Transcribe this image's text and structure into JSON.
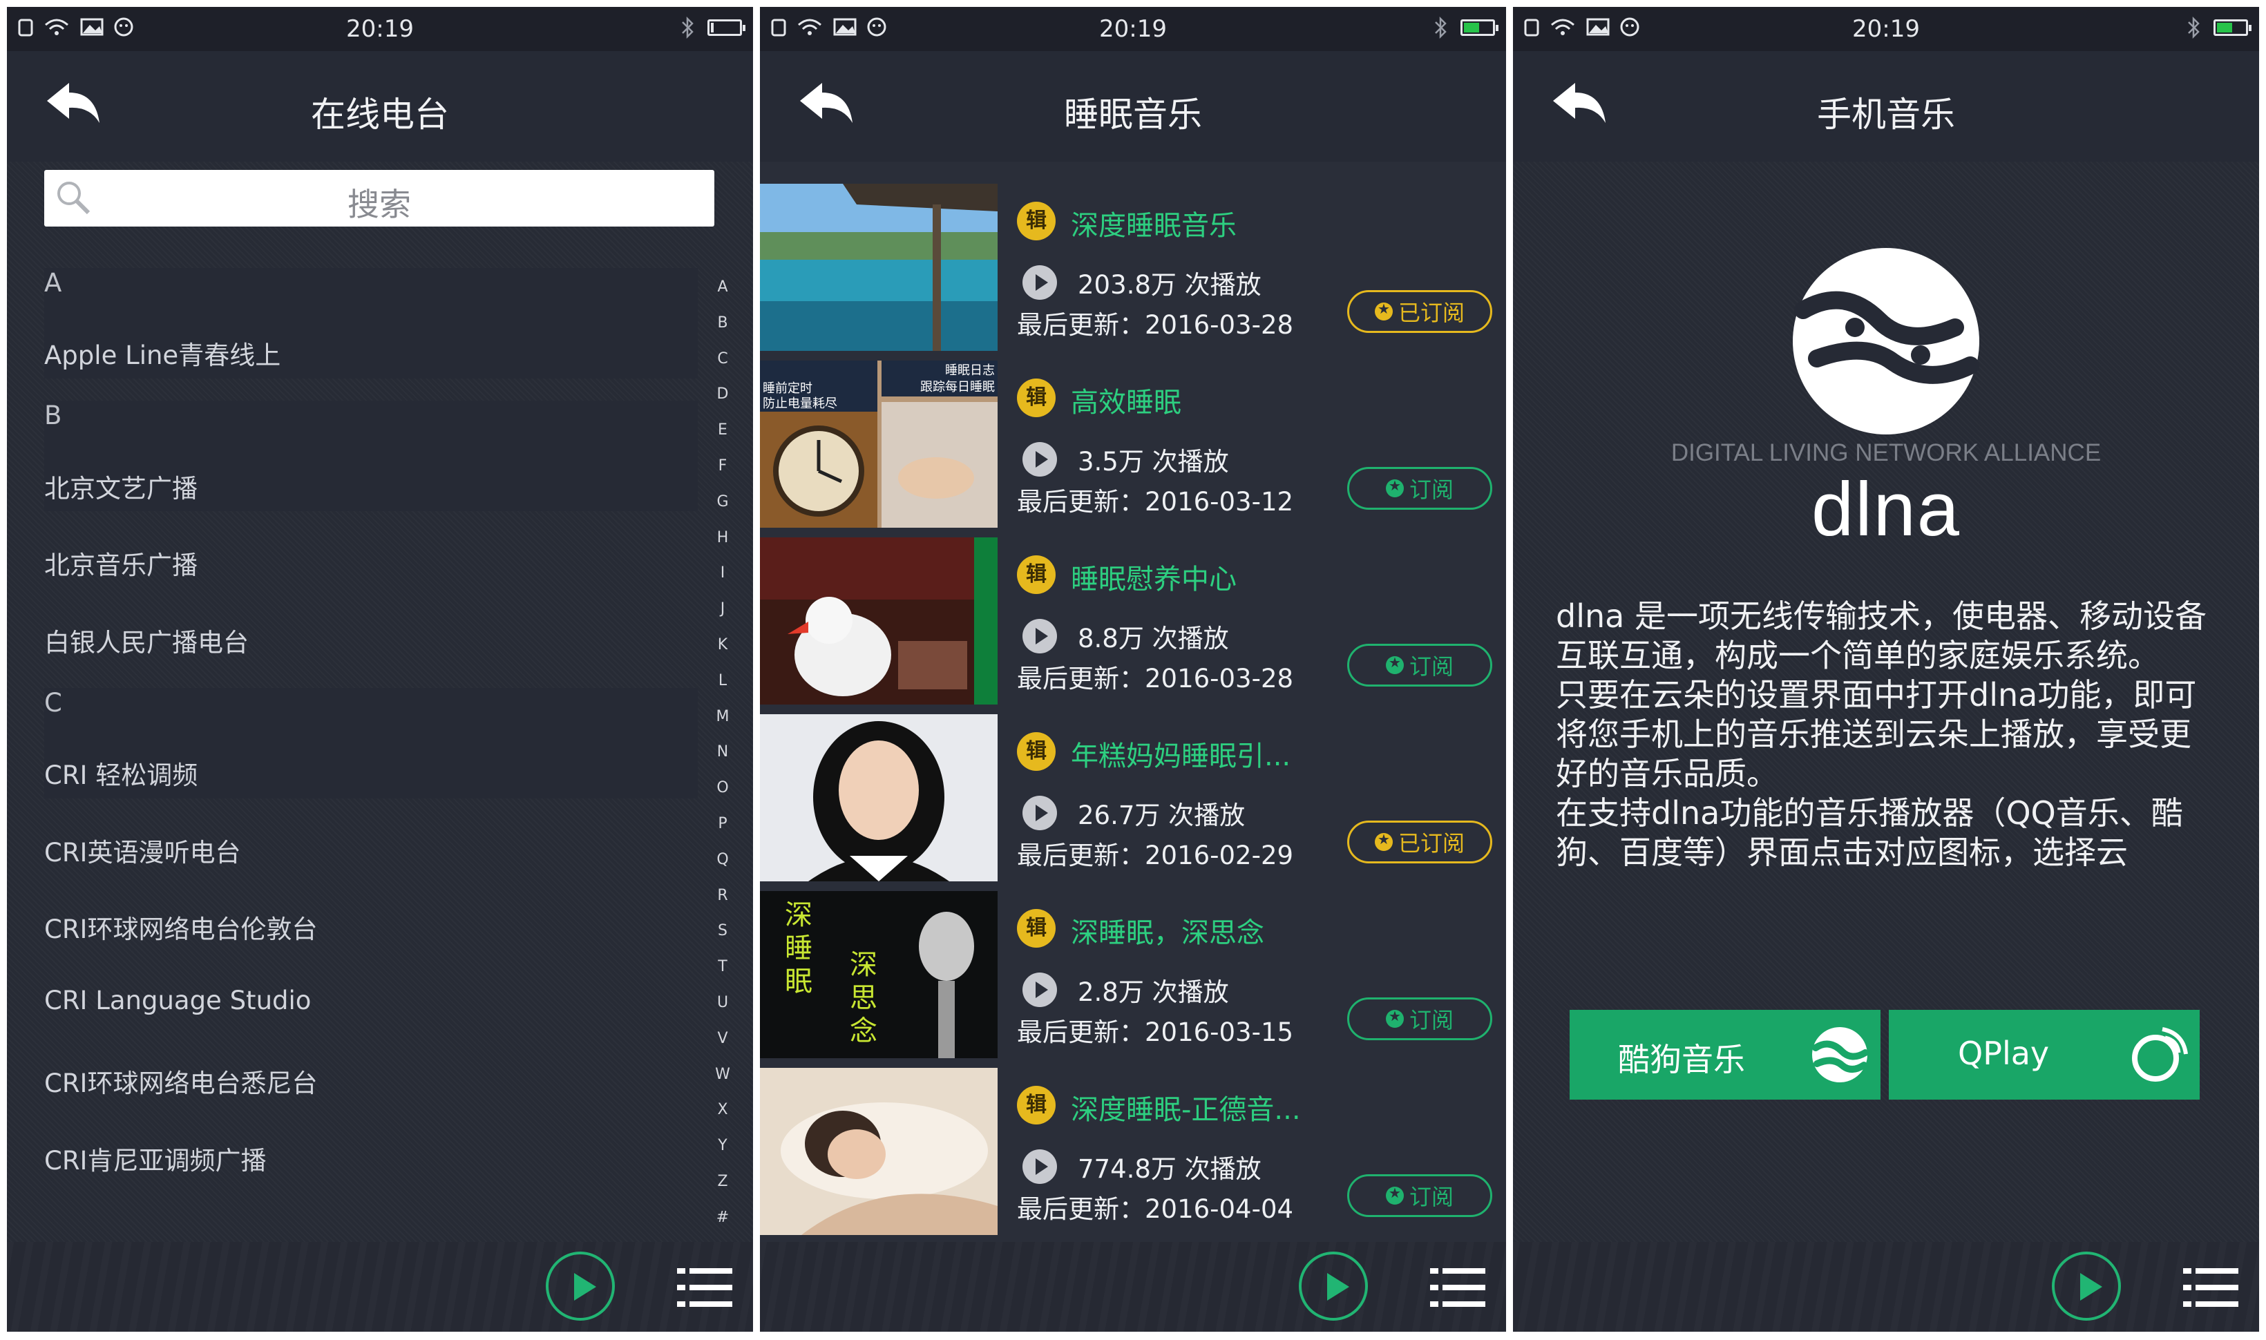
{
  "status": {
    "time": "20:19"
  },
  "panel1": {
    "title": "在线电台",
    "search_placeholder": "搜索",
    "list": [
      "A",
      "Apple Line青春线上",
      "B",
      "北京文艺广播",
      "北京音乐广播",
      "白银人民广播电台",
      "C",
      "CRI 轻松调频",
      "CRI英语漫听电台",
      "CRI环球网络电台伦敦台",
      "CRI Language Studio",
      "CRI环球网络电台悉尼台",
      "CRI肯尼亚调频广播"
    ],
    "alphabet": [
      "A",
      "B",
      "C",
      "D",
      "E",
      "F",
      "G",
      "H",
      "I",
      "J",
      "K",
      "L",
      "M",
      "N",
      "O",
      "P",
      "Q",
      "R",
      "S",
      "T",
      "U",
      "V",
      "W",
      "X",
      "Y",
      "Z",
      "#"
    ]
  },
  "panel2": {
    "title": "睡眠音乐",
    "badge": "辑",
    "albums": [
      {
        "name": "深度睡眠音乐",
        "plays": "203.8万 次播放",
        "updated": "最后更新：2016-03-28",
        "sub": "已订阅",
        "subscribed": true
      },
      {
        "name": "高效睡眠",
        "plays": "3.5万 次播放",
        "updated": "最后更新：2016-03-12",
        "sub": "订阅",
        "subscribed": false
      },
      {
        "name": "睡眠慰养中心",
        "plays": "8.8万 次播放",
        "updated": "最后更新：2016-03-28",
        "sub": "订阅",
        "subscribed": false
      },
      {
        "name": "年糕妈妈睡眠引...",
        "plays": "26.7万 次播放",
        "updated": "最后更新：2016-02-29",
        "sub": "已订阅",
        "subscribed": true
      },
      {
        "name": "深睡眠，深思念",
        "plays": "2.8万 次播放",
        "updated": "最后更新：2016-03-15",
        "sub": "订阅",
        "subscribed": false
      },
      {
        "name": "深度睡眠-正德音...",
        "plays": "774.8万 次播放",
        "updated": "最后更新：2016-04-04",
        "sub": "订阅",
        "subscribed": false
      }
    ],
    "thumb_texts": {
      "t2_top": "睡眠日志",
      "t2_top2": "跟踪每日睡眠",
      "t2_left": "睡前定时",
      "t2_left2": "防止电量耗尽",
      "t5_a": "深",
      "t5_b": "睡",
      "t5_c": "眠",
      "t5_d": "深",
      "t5_e": "思",
      "t5_f": "念"
    }
  },
  "panel3": {
    "title": "手机音乐",
    "alliance": "DIGITAL LIVING NETWORK ALLIANCE",
    "wordmark": "dlna",
    "desc": [
      "dlna 是一项无线传输技术，使电器、移动设备互联互通，构成一个简单的家庭娱乐系统。",
      "只要在云朵的设置界面中打开dlna功能，即可将您手机上的音乐推送到云朵上播放，享受更好的音乐品质。",
      "在支持dlna功能的音乐播放器（QQ音乐、酷狗、百度等）界面点击对应图标，选择云"
    ],
    "btn_kugou": "酷狗音乐",
    "btn_qplay": "QPlay"
  },
  "colors": {
    "accent_green": "#21b573",
    "subscribed_gold": "#e6b91e",
    "background": "#21242e"
  },
  "icons": [
    "back-arrow-icon",
    "search-icon",
    "play-icon",
    "playlist-icon",
    "wifi-icon",
    "bluetooth-icon",
    "battery-icon",
    "dlna-logo-icon",
    "kugou-icon",
    "qplay-icon"
  ]
}
